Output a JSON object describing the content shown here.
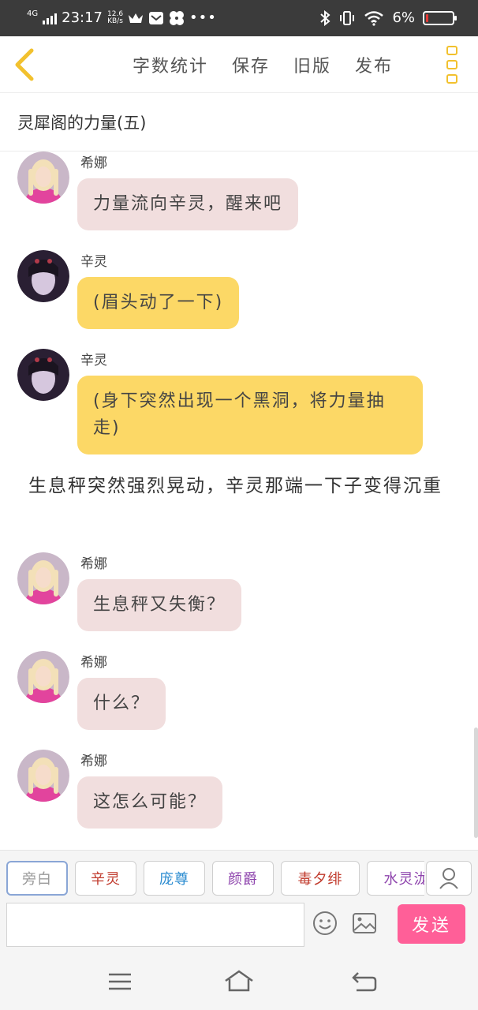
{
  "status_bar": {
    "network": "4G",
    "time": "23:17",
    "speed_value": "12.6",
    "speed_unit": "KB/s",
    "battery": "6%",
    "battery_level": 0.06,
    "icons": [
      "crown-icon",
      "mail-icon",
      "pinwheel-icon",
      "more-dots-icon",
      "bluetooth-icon",
      "vibrate-icon",
      "wifi-icon",
      "battery-icon"
    ]
  },
  "toolbar": {
    "word_count": "字数统计",
    "save": "保存",
    "old_version": "旧版",
    "publish": "发布"
  },
  "chapter_title": "灵犀阁的力量(五)",
  "messages": [
    {
      "name": "希娜",
      "text": "力量流向辛灵，醒来吧",
      "style": "pink"
    },
    {
      "name": "辛灵",
      "text": "(眉头动了一下)",
      "style": "yellow"
    },
    {
      "name": "辛灵",
      "text": "(身下突然出现一个黑洞，将力量抽走)",
      "style": "yellow"
    },
    {
      "narration": "生息秤突然强烈晃动，辛灵那端一下子变得沉重"
    },
    {
      "name": "希娜",
      "text": "生息秤又失衡？",
      "style": "pink"
    },
    {
      "name": "希娜",
      "text": "什么？",
      "style": "pink"
    },
    {
      "name": "希娜",
      "text": "这怎么可能？",
      "style": "pink"
    }
  ],
  "characters": [
    {
      "label": "旁白",
      "color": "#9a9a9a"
    },
    {
      "label": "辛灵",
      "color": "#c0392b"
    },
    {
      "label": "庞尊",
      "color": "#2a8bd0"
    },
    {
      "label": "颜爵",
      "color": "#8e44ad"
    },
    {
      "label": "毒夕绯",
      "color": "#c0392b"
    },
    {
      "label": "水灵泷",
      "color": "#8e44ad"
    }
  ],
  "input": {
    "value": "",
    "placeholder": ""
  },
  "send_label": "发送",
  "colors": {
    "accent_yellow": "#f2c12e",
    "send_pink": "#ff5f98",
    "bubble_pink": "#f1dede",
    "bubble_yellow": "#fcd866"
  }
}
